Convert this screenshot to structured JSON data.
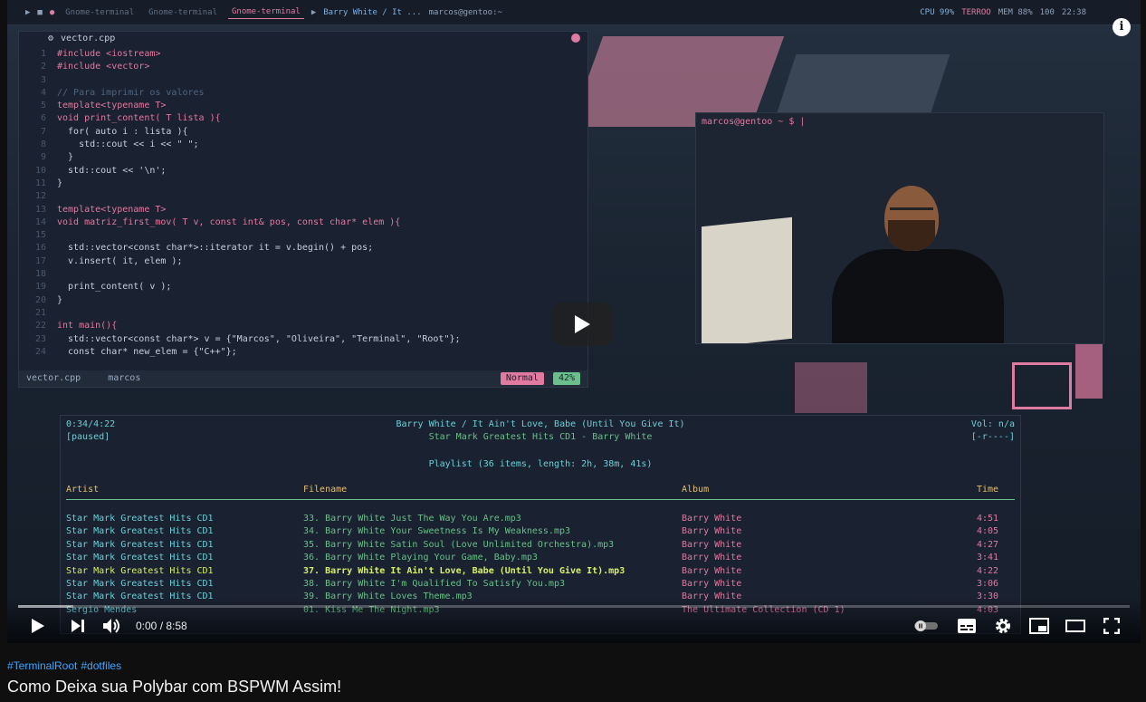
{
  "video": {
    "polybar": {
      "workspaces": [
        "Gnome-terminal",
        "Gnome-terminal",
        "Gnome-terminal"
      ],
      "now_playing": "Barry White / It ...",
      "user_host": "marcos@gentoo:~",
      "cpu": "CPU 99%",
      "temp": "TERROO",
      "mem": "MEM 88%",
      "battery": "100",
      "clock": "22:38"
    },
    "editor": {
      "tab_name": "vector.cpp",
      "lines": [
        {
          "n": "1",
          "t": "#include <iostream>"
        },
        {
          "n": "2",
          "t": "#include <vector>"
        },
        {
          "n": "3",
          "t": ""
        },
        {
          "n": "4",
          "t": "// Para imprimir os valores"
        },
        {
          "n": "5",
          "t": "template<typename T>"
        },
        {
          "n": "6",
          "t": "void print_content( T lista ){"
        },
        {
          "n": "7",
          "t": "  for( auto i : lista ){"
        },
        {
          "n": "8",
          "t": "    std::cout << i << \" \";"
        },
        {
          "n": "9",
          "t": "  }"
        },
        {
          "n": "10",
          "t": "  std::cout << '\\n';"
        },
        {
          "n": "11",
          "t": "}"
        },
        {
          "n": "12",
          "t": ""
        },
        {
          "n": "13",
          "t": "template<typename T>"
        },
        {
          "n": "14",
          "t": "void matriz_first_mov( T v, const int& pos, const char* elem ){"
        },
        {
          "n": "15",
          "t": ""
        },
        {
          "n": "16",
          "t": "  std::vector<const char*>::iterator it = v.begin() + pos;"
        },
        {
          "n": "17",
          "t": "  v.insert( it, elem );"
        },
        {
          "n": "18",
          "t": ""
        },
        {
          "n": "19",
          "t": "  print_content( v );"
        },
        {
          "n": "20",
          "t": "}"
        },
        {
          "n": "21",
          "t": ""
        },
        {
          "n": "22",
          "t": "int main(){"
        },
        {
          "n": "23",
          "t": "  std::vector<const char*> v = {\"Marcos\", \"Oliveira\", \"Terminal\", \"Root\"};"
        },
        {
          "n": "24",
          "t": "  const char* new_elem = {\"C++\"};"
        }
      ],
      "status_file": "vector.cpp",
      "status_dir": "marcos",
      "mode": "Normal",
      "percent": "42%"
    },
    "terminal": {
      "prompt": "marcos@gentoo ~ $ |"
    },
    "music": {
      "elapsed": "0:34/4:22",
      "state": "[paused]",
      "now_playing": "Barry White / It Ain't Love, Babe (Until You Give It)",
      "album_line": "Star Mark Greatest Hits CD1 - Barry White",
      "volume": "Vol: n/a",
      "flags": "[-r----]",
      "playlist": "Playlist (36 items, length: 2h, 38m, 41s)",
      "columns": [
        "Artist",
        "Filename",
        "Album",
        "Time"
      ],
      "rows": [
        {
          "artist": "Star Mark Greatest Hits CD1",
          "file": "33. Barry White  Just The Way You Are.mp3",
          "album": "Barry White",
          "time": "4:51"
        },
        {
          "artist": "Star Mark Greatest Hits CD1",
          "file": "34. Barry White  Your Sweetness Is My Weakness.mp3",
          "album": "Barry White",
          "time": "4:05"
        },
        {
          "artist": "Star Mark Greatest Hits CD1",
          "file": "35. Barry White  Satin Soul (Love Unlimited Orchestra).mp3",
          "album": "Barry White",
          "time": "4:27"
        },
        {
          "artist": "Star Mark Greatest Hits CD1",
          "file": "36. Barry White  Playing Your Game, Baby.mp3",
          "album": "Barry White",
          "time": "3:41"
        },
        {
          "artist": "Star Mark Greatest Hits CD1",
          "file": "37. Barry White  It Ain't Love, Babe (Until You Give It).mp3",
          "album": "Barry White",
          "time": "4:22",
          "playing": true
        },
        {
          "artist": "Star Mark Greatest Hits CD1",
          "file": "38. Barry White  I'm Qualified To Satisfy You.mp3",
          "album": "Barry White",
          "time": "3:06"
        },
        {
          "artist": "Star Mark Greatest Hits CD1",
          "file": "39. Barry White  Loves Theme.mp3",
          "album": "Barry White",
          "time": "3:30"
        },
        {
          "artist": "Sergio Mendes",
          "file": "01. Kiss Me The Night.mp3",
          "album": "The Ultimate Collection (CD 1)",
          "time": "4:03"
        }
      ]
    }
  },
  "player": {
    "time_display": "0:00 / 8:58",
    "progress_fraction": 0.0,
    "buffered_fraction": 0.05
  },
  "meta": {
    "tags": [
      "#TerminalRoot",
      "#dotfiles"
    ],
    "title": "Como Deixa sua Polybar com BSPWM Assim!"
  },
  "colors": {
    "link": "#3ea6ff",
    "accent_pink": "#e07aa0"
  }
}
